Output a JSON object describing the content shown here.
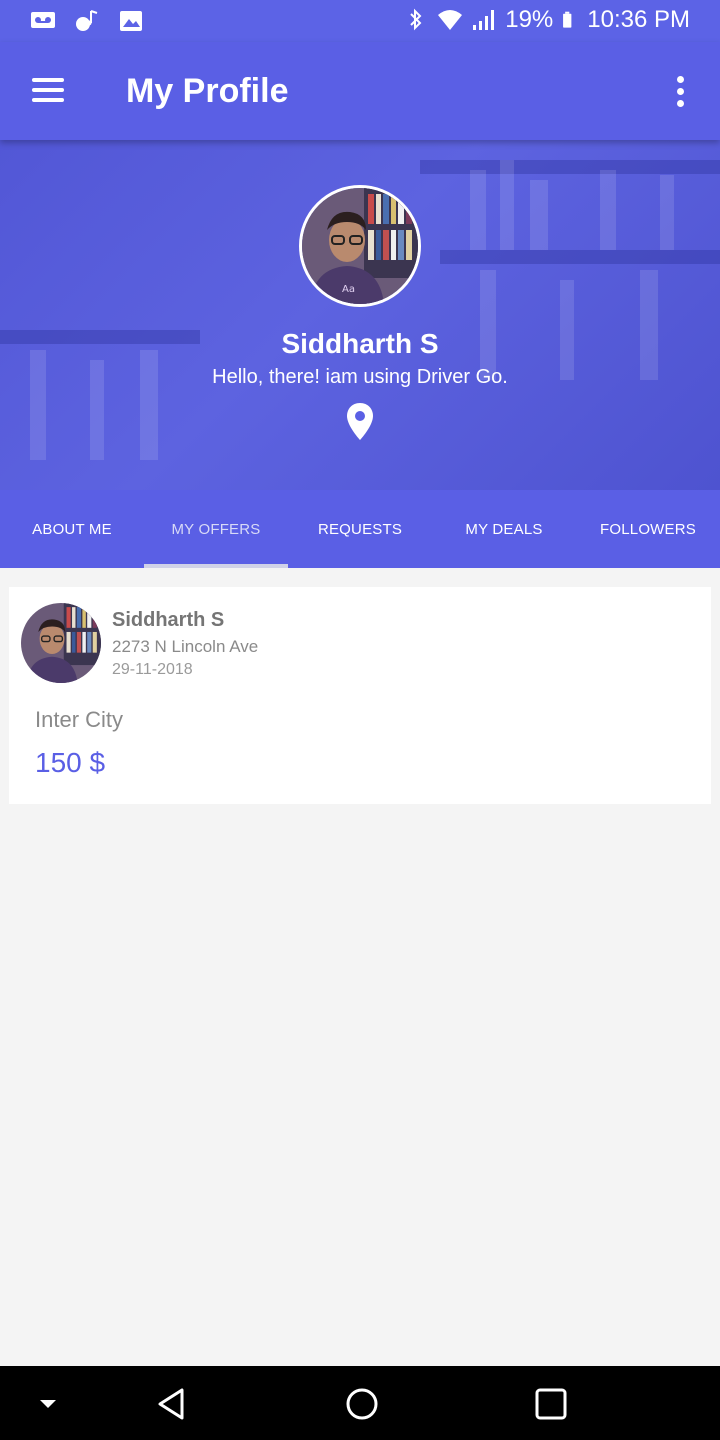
{
  "status_bar": {
    "battery": "19%",
    "time": "10:36 PM",
    "left_icons": [
      "voicemail-icon",
      "bluetooth-music-icon",
      "image-icon"
    ],
    "right_icons": [
      "bluetooth-icon",
      "wifi-icon",
      "signal-icon",
      "battery-icon"
    ]
  },
  "app_bar": {
    "title": "My Profile",
    "menu_icon": "menu-icon",
    "more_icon": "more-vert-icon"
  },
  "profile": {
    "name": "Siddharth S",
    "status": "Hello, there! iam using Driver Go.",
    "location_icon": "location-pin-icon"
  },
  "tabs": [
    {
      "label": "ABOUT ME"
    },
    {
      "label": "MY OFFERS",
      "active": true
    },
    {
      "label": "REQUESTS"
    },
    {
      "label": "MY DEALS"
    },
    {
      "label": "FOLLOWERS"
    }
  ],
  "offer": {
    "name": "Siddharth S",
    "address": "2273 N Lincoln Ave",
    "date": "29-11-2018",
    "type": "Inter City",
    "price": "150 $"
  },
  "colors": {
    "primary": "#5a5fe5",
    "background": "#f4f4f4",
    "price": "#5a5fe5"
  },
  "nav_bar": {
    "items": [
      "hide-keyboard-icon",
      "back-icon",
      "home-icon",
      "recents-icon"
    ]
  }
}
